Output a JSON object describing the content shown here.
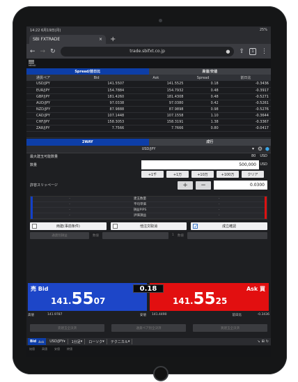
{
  "status": {
    "time_date": "14:22  6月19日(月)",
    "battery": "25%"
  },
  "browser": {
    "tab_title": "SBI FXTRADE",
    "tab_close": "×",
    "new_tab": "+",
    "url": "trade.sbifxt.co.jp",
    "tab_count": "1"
  },
  "menu": {
    "label": "MENU"
  },
  "rate_tabs": [
    "Spread/前日比",
    "高値/安値"
  ],
  "rate_table": {
    "headers": [
      "通貨ペア",
      "Bid",
      "Ask",
      "Spread",
      "前日比"
    ],
    "rows": [
      [
        "USD/JPY",
        "141.5507",
        "141.5525",
        "0.18",
        "-0.3436"
      ],
      [
        "EUR/JPY",
        "154.7884",
        "154.7932",
        "0.48",
        "-0.3917"
      ],
      [
        "GBP/JPY",
        "181.4260",
        "181.4308",
        "0.48",
        "-0.5271"
      ],
      [
        "AUD/JPY",
        "97.0338",
        "97.0380",
        "0.42",
        "-0.5261"
      ],
      [
        "NZD/JPY",
        "87.9888",
        "87.9898",
        "0.98",
        "-0.5276"
      ],
      [
        "CAD/JPY",
        "107.1448",
        "107.1558",
        "1.10",
        "-0.3644"
      ],
      [
        "CHF/JPY",
        "158.3053",
        "158.3191",
        "1.38",
        "-0.3367"
      ],
      [
        "ZAR/JPY",
        "7.7566",
        "7.7666",
        "0.80",
        "-0.0417"
      ],
      [
        "",
        "",
        "",
        "",
        ""
      ]
    ]
  },
  "order_tabs": [
    "2WAY",
    "成行"
  ],
  "order": {
    "pair": "USD/JPY",
    "max_label": "最大建玉可能数量",
    "max_value": "80",
    "max_unit": "USD",
    "qty_label": "数量",
    "qty_value": "500,000",
    "qty_unit": "USD",
    "quick_buttons": [
      "+1千",
      "+1万",
      "+10万",
      "+100万",
      "クリア"
    ],
    "slip_label": "許容スリッページ",
    "plus": "+",
    "minus": "−",
    "slip_value": "0.0300"
  },
  "info_rows": [
    {
      "left": "-",
      "label": "建玉数量",
      "right": "-"
    },
    {
      "left": "-",
      "label": "平均単価",
      "right": "-"
    },
    {
      "left": "-",
      "label": "損益PIPS",
      "right": "-"
    },
    {
      "left": "-",
      "label": "評価損益",
      "right": "-"
    }
  ],
  "checks": [
    "両建(事前条件)",
    "他注文取消",
    "成立確認"
  ],
  "disabled_row": {
    "a": "通貨別損益",
    "b": "数値",
    "c": "1",
    "d": "数値"
  },
  "bid": {
    "label": "売 Bid",
    "price_small": "141.",
    "price_big": "55",
    "price_tail": "07"
  },
  "ask": {
    "label": "Ask 買",
    "price_small": "141.",
    "price_big": "55",
    "price_tail": "25"
  },
  "spread": "0.18",
  "hilo": {
    "high_label": "高値",
    "high": "141.9787",
    "low_label": "安値",
    "low": "141.4490",
    "change_label": "前日比",
    "change": "-0.3436"
  },
  "bottom_buttons": [
    "売建玉全決済",
    "通貨ペア別全決済",
    "買建玉全決済"
  ],
  "bottom_bar": {
    "bid_label": "Bid",
    "ask_label": "Ask",
    "pair": "USD/JPY",
    "tf": "1分足",
    "candle": "ローソク",
    "tech": "テクニカル"
  },
  "footer_cols": [
    "始値",
    "高値",
    "安値",
    "終値"
  ],
  "colors": {
    "bid": "#1d46c8",
    "ask": "#e20f10",
    "tab_active": "#0d3ea8"
  }
}
